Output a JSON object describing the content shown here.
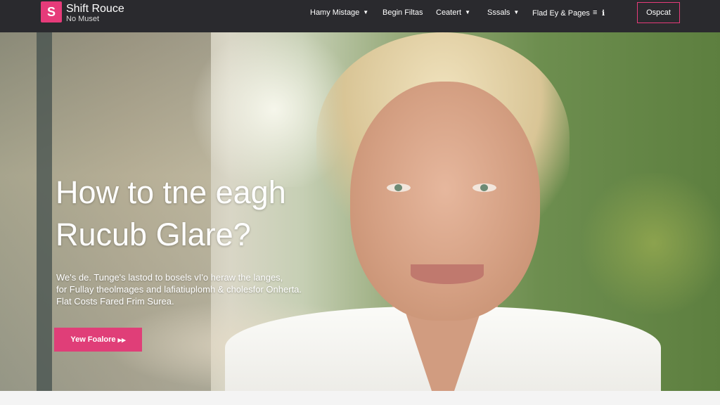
{
  "nav": {
    "logo_glyph": "S",
    "brand_name": "Shift Rouce",
    "brand_sub": "No Muset",
    "menu": [
      {
        "label": "Hamy Mistage",
        "dropdown": true
      },
      {
        "label": "Begin Filtas",
        "dropdown": false
      },
      {
        "label": "Ceatert",
        "dropdown": true
      },
      {
        "label": "Sssals",
        "dropdown": true
      },
      {
        "label": "Flad Ey & Pages",
        "dropdown": false
      }
    ],
    "menu_icon": "menu-icon",
    "search_icon": "search-icon",
    "button_label": "Ospcat"
  },
  "hero": {
    "title_line1": "How to tne eagh",
    "title_line2": "Rucub Glare?",
    "desc_line1": "We's de. Tunge's lastod to bosels vI'o heraw the langes,",
    "desc_line2": "for Fullay theolmages and lafiatiuplomh & cholesfor Onherta.",
    "desc_line3": "Flat Costs Fared Frim Surea.",
    "cta_label": "Yew Foalore",
    "cta_arrow": "▸▸"
  },
  "colors": {
    "accent": "#e03e78",
    "nav_bg": "#2a2a2e"
  }
}
